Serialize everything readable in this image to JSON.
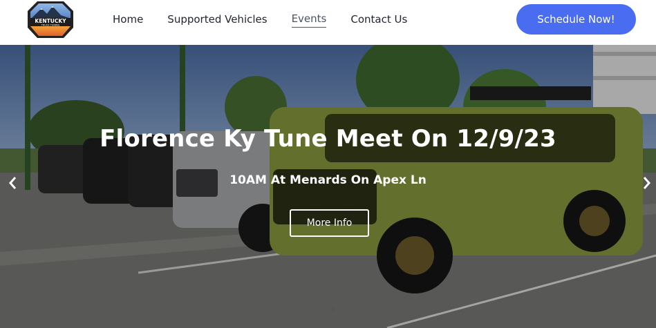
{
  "brand": {
    "logo_line1": "KENTUCKY",
    "logo_line2": "TRUCK TUNING"
  },
  "nav": {
    "items": [
      {
        "label": "Home"
      },
      {
        "label": "Supported Vehicles"
      },
      {
        "label": "Events"
      },
      {
        "label": "Contact Us"
      }
    ],
    "active_index": 2
  },
  "cta": {
    "label": "Schedule Now!",
    "color": "#4a6cf0"
  },
  "hero": {
    "title": "Florence Ky Tune Meet On 12/9/23",
    "subtitle": "10AM At Menards On Apex Ln",
    "button_label": "More Info",
    "prev_icon": "chevron-left-icon",
    "next_icon": "chevron-right-icon"
  }
}
